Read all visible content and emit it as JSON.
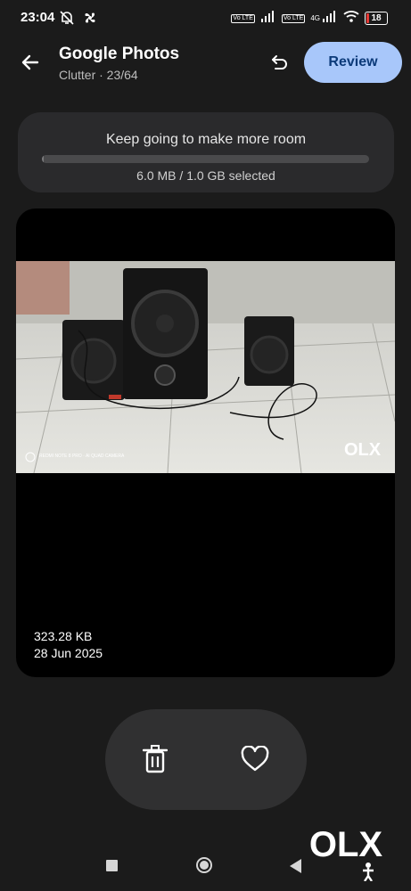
{
  "status_bar": {
    "time": "23:04",
    "battery_level": "18",
    "network_label": "4G",
    "volte_label": "Vo LTE",
    "icons": [
      "mute-icon",
      "fan-icon",
      "signal-icon",
      "wifi-icon",
      "battery-icon"
    ],
    "battery_color": "#e53935"
  },
  "header": {
    "title": "Google Photos",
    "subtitle": "Clutter · 23/64",
    "review_label": "Review",
    "review_color": "#a8c7fa"
  },
  "progress": {
    "title": "Keep going to make more room",
    "label": "6.0 MB / 1.0 GB selected",
    "fraction": 0.006
  },
  "photo": {
    "size": "323.28 KB",
    "date": "28 Jun 2025",
    "image_watermark": "OLX",
    "camera_watermark": "REDMI NOTE 8 PRO · AI QUAD CAMERA"
  },
  "actions": {
    "icons": [
      "trash-icon",
      "heart-icon"
    ]
  },
  "nav": {
    "icons": [
      "recents-icon",
      "home-icon",
      "back-icon"
    ]
  },
  "watermark": {
    "text": "OLX"
  }
}
